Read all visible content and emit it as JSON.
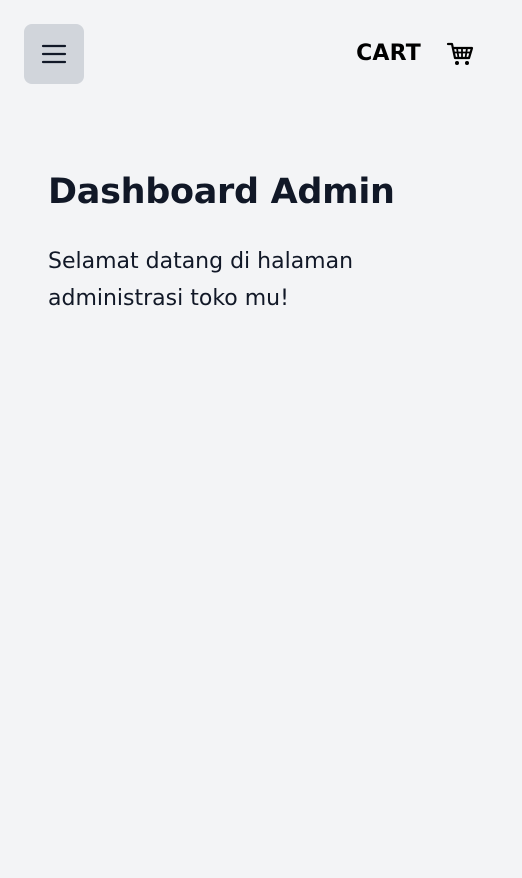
{
  "header": {
    "menu_icon": "menu-icon",
    "cart_label": "CART",
    "cart_icon": "cart-icon"
  },
  "main": {
    "title": "Dashboard Admin",
    "welcome_text": "Selamat datang di halaman administrasi toko mu!"
  },
  "colors": {
    "background": "#f3f4f6",
    "menu_button_bg": "#d1d5db",
    "text_primary": "#111827",
    "cart_text": "#000000"
  }
}
